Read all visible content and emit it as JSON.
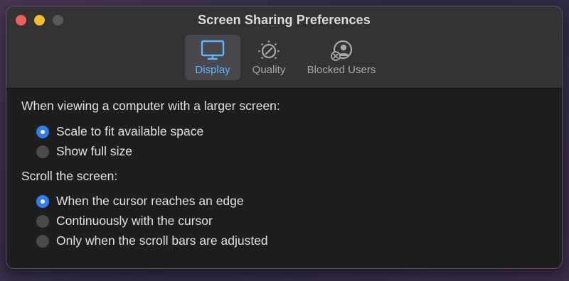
{
  "window": {
    "title": "Screen Sharing Preferences"
  },
  "toolbar": {
    "tabs": [
      {
        "label": "Display",
        "icon": "display-icon",
        "selected": true
      },
      {
        "label": "Quality",
        "icon": "quality-dial-icon",
        "selected": false
      },
      {
        "label": "Blocked Users",
        "icon": "blocked-user-icon",
        "selected": false
      }
    ]
  },
  "display": {
    "larger_screen": {
      "label": "When viewing a computer with a larger screen:",
      "options": [
        {
          "label": "Scale to fit available space",
          "selected": true
        },
        {
          "label": "Show full size",
          "selected": false
        }
      ]
    },
    "scroll": {
      "label": "Scroll the screen:",
      "options": [
        {
          "label": "When the cursor reaches an edge",
          "selected": true
        },
        {
          "label": "Continuously with the cursor",
          "selected": false
        },
        {
          "label": "Only when the scroll bars are adjusted",
          "selected": false
        }
      ]
    }
  },
  "colors": {
    "accent": "#2f7ef0",
    "selected_tab_text": "#5fb8ff",
    "close": "#ee5f57",
    "minimize": "#f2bc2e",
    "zoom_inactive": "#5a5a5c"
  }
}
